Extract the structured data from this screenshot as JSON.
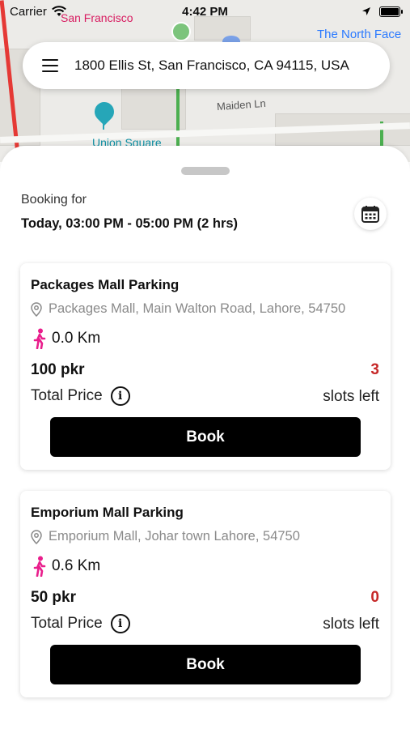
{
  "status_bar": {
    "carrier": "Carrier",
    "time": "4:42 PM"
  },
  "map": {
    "labels": {
      "top_place": "San Francisco",
      "store": "The North Face",
      "street": "Maiden Ln",
      "landmark": "Union Square"
    }
  },
  "search": {
    "address": "1800 Ellis St, San Francisco, CA 94115, USA"
  },
  "booking": {
    "label": "Booking for",
    "time_range": "Today, 03:00 PM - 05:00 PM (2 hrs)"
  },
  "parkings": [
    {
      "name": "Packages Mall Parking",
      "address": "Packages Mall, Main Walton Road, Lahore, 54750",
      "distance": "0.0 Km",
      "price": "100 pkr",
      "slots": "3",
      "total_label": "Total Price",
      "slots_label": "slots left",
      "book_label": "Book"
    },
    {
      "name": "Emporium Mall Parking",
      "address": "Emporium Mall, Johar town Lahore, 54750",
      "distance": "0.6 Km",
      "price": "50 pkr",
      "slots": "0",
      "total_label": "Total Price",
      "slots_label": "slots left",
      "book_label": "Book"
    }
  ],
  "colors": {
    "slots_accent": "#c62828",
    "walk_icon": "#e91e8c",
    "book_button": "#000000"
  }
}
